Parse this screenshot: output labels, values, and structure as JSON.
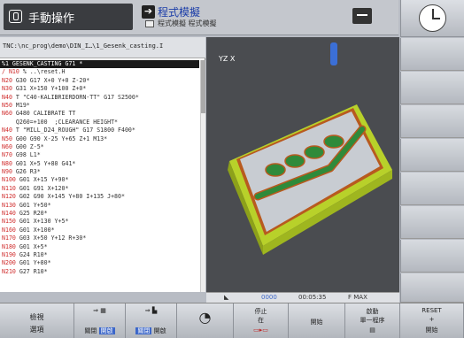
{
  "header": {
    "mode_manual": "手動操作",
    "mode_sim_title": "程式模擬",
    "mode_sim_sub": "程式模擬 程式模擬"
  },
  "program": {
    "path": "TNC:\\nc_prog\\demo\\DIN_I…\\1_Gesenk_casting.I",
    "lines": [
      {
        "n": "%1",
        "t": " GESENK_CASTING G71 *",
        "sel": true
      },
      {
        "n": "/ N10",
        "t": " % ..\\reset.H"
      },
      {
        "n": "N20",
        "t": " G30 G17 X+0 Y+0 Z-20*"
      },
      {
        "n": "N30",
        "t": " G31 X+150 Y+100 Z+0*"
      },
      {
        "n": "N40",
        "t": " T \"C40-KALIBRIERDORN-TT\" G17 S2500*"
      },
      {
        "n": "N50",
        "t": " M19*"
      },
      {
        "n": "N60",
        "t": " G480 CALIBRATE TT"
      },
      {
        "n": "",
        "t": "    Q260=+100  ;CLEARANCE HEIGHT*"
      },
      {
        "n": "N40",
        "t": " T \"MILL_D24_ROUGH\" G17 S1800 F400*"
      },
      {
        "n": "N50",
        "t": " G00 G90 X-25 Y+65 Z+1 M13*"
      },
      {
        "n": "N60",
        "t": " G00 Z-5*"
      },
      {
        "n": "N70",
        "t": " G98 L1*"
      },
      {
        "n": "N80",
        "t": " G01 X+5 Y+80 G41*"
      },
      {
        "n": "N90",
        "t": " G26 R3*"
      },
      {
        "n": "N100",
        "t": " G01 X+15 Y+90*"
      },
      {
        "n": "N110",
        "t": " G01 G91 X+120*"
      },
      {
        "n": "N120",
        "t": " G02 G90 X+145 Y+80 I+135 J+80*"
      },
      {
        "n": "N130",
        "t": " G01 Y+50*"
      },
      {
        "n": "N140",
        "t": " G25 R20*"
      },
      {
        "n": "N150",
        "t": " G01 X+130 Y+5*"
      },
      {
        "n": "N160",
        "t": " G01 X+100*"
      },
      {
        "n": "N170",
        "t": " G03 X+50 Y+12 R+30*"
      },
      {
        "n": "N180",
        "t": " G01 X+5*"
      },
      {
        "n": "N190",
        "t": " G24 R10*"
      },
      {
        "n": "N200",
        "t": " G01 Y+80*"
      },
      {
        "n": "N210",
        "t": " G27 R10*"
      }
    ]
  },
  "view": {
    "axis_label": "YZ X"
  },
  "status": {
    "dots": "0000",
    "time": "00:05:35",
    "feed": "F MAX"
  },
  "softkeys": {
    "sk1_a": "檢視",
    "sk1_b": "選項",
    "sk2_off": "關閉",
    "sk2_on": "開啟",
    "sk3_off": "關閉",
    "sk3_on": "開啟",
    "sk5_a": "停止",
    "sk5_b": "在",
    "sk6": "開始",
    "sk7_a": "啟動",
    "sk7_b": "單一程序",
    "sk8_a": "RESET",
    "sk8_b": "+",
    "sk8_c": "開始"
  },
  "colors": {
    "part_base": "#b8d12a",
    "part_top": "#c8ccd2",
    "pocket": "#2f8a3a",
    "slot_edge": "#b85a1f",
    "tool": "#3b6fd6",
    "accent": "#1a3ca8"
  }
}
